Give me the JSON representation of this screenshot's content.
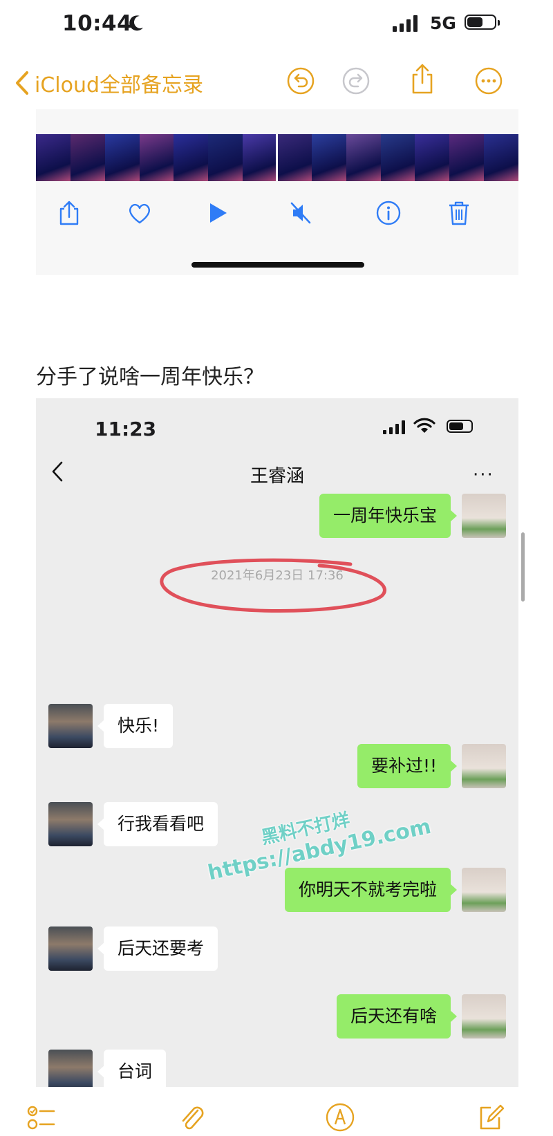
{
  "status_bar": {
    "time": "10:44",
    "network": "5G"
  },
  "nav": {
    "back_label": "iCloud全部备忘录"
  },
  "video_strip_colors": [
    "#3b2a8a",
    "#5b2a6e",
    "#2a3aa0",
    "#7a3a8a",
    "#2b2f9a",
    "#1d2a78",
    "#4a3aa8",
    "#3a2a7a",
    "#2c3f9e",
    "#6a4a9a",
    "#283a8a",
    "#3a2f9a",
    "#5a2a7e",
    "#2a3090"
  ],
  "note": {
    "caption": "分手了说啥一周年快乐？"
  },
  "chat": {
    "time": "11:23",
    "contact_name": "王睿涵",
    "more": "···",
    "timestamp": "2021年6月23日 17:36",
    "messages": [
      {
        "side": "right",
        "text": "一周年快乐宝"
      },
      {
        "side": "left",
        "text": "快乐!"
      },
      {
        "side": "right",
        "text": "要补过!!"
      },
      {
        "side": "left",
        "text": "行我看看吧"
      },
      {
        "side": "right",
        "text": "你明天不就考完啦"
      },
      {
        "side": "left",
        "text": "后天还要考"
      },
      {
        "side": "right",
        "text": "后天还有啥"
      },
      {
        "side": "left",
        "text": "台词"
      }
    ]
  },
  "watermark": {
    "line1": "黑料不打烊",
    "line2": "https://abdy19.com"
  },
  "colors": {
    "accent": "#e6a321",
    "bubble_green": "#95ec69",
    "annotation_red": "#e0505a"
  }
}
